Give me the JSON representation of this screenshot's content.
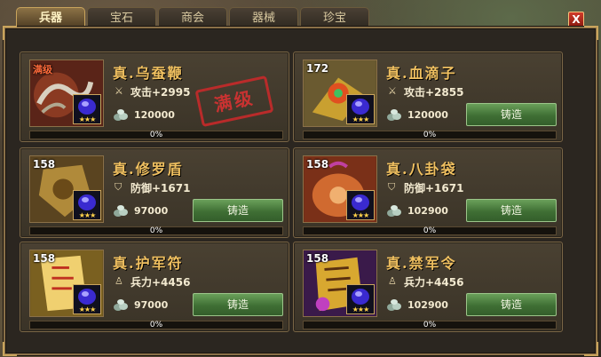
{
  "tabs": [
    {
      "label": "兵器",
      "active": true
    },
    {
      "label": "宝石",
      "active": false
    },
    {
      "label": "商会",
      "active": false
    },
    {
      "label": "器械",
      "active": false
    },
    {
      "label": "珍宝",
      "active": false
    }
  ],
  "close_label": "X",
  "forge_label": "铸造",
  "items": [
    {
      "level": "满级",
      "name": "真.乌蚕鞭",
      "stat_icon": "sword-icon",
      "stat": "攻击+2995",
      "cost": "120000",
      "progress": "0%",
      "stamp": "满级"
    },
    {
      "level": "172",
      "name": "真.血滴子",
      "stat_icon": "sword-icon",
      "stat": "攻击+2855",
      "cost": "120000",
      "progress": "0%"
    },
    {
      "level": "158",
      "name": "真.修罗盾",
      "stat_icon": "shield-icon",
      "stat": "防御+1671",
      "cost": "97000",
      "progress": "0%"
    },
    {
      "level": "158",
      "name": "真.八卦袋",
      "stat_icon": "shield-icon",
      "stat": "防御+1671",
      "cost": "102900",
      "progress": "0%"
    },
    {
      "level": "158",
      "name": "真.护军符",
      "stat_icon": "soldier-icon",
      "stat": "兵力+4456",
      "cost": "97000",
      "progress": "0%"
    },
    {
      "level": "158",
      "name": "真.禁军令",
      "stat_icon": "soldier-icon",
      "stat": "兵力+4456",
      "cost": "102900",
      "progress": "0%"
    }
  ],
  "colors": {
    "accent": "#f0c060",
    "stamp": "#d43232",
    "button": "#4f8a40"
  }
}
